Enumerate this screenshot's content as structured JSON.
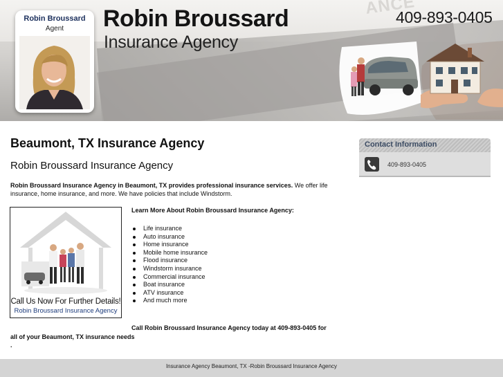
{
  "header": {
    "agent_name": "Robin Broussard",
    "agent_role": "Agent",
    "brand_title": "Robin Broussard",
    "brand_subtitle": "Insurance Agency",
    "phone": "409-893-0405",
    "watermark": "ANCE"
  },
  "main": {
    "title": "Beaumont, TX Insurance Agency",
    "subtitle": "Robin Broussard Insurance Agency",
    "intro_bold": "Robin Broussard Insurance Agency in Beaumont, TX provides professional insurance services.",
    "intro_rest": " We offer life insurance, home insurance, and more. We have policies that include Windstorm.",
    "promo_cta": "Call Us Now For Further Details!",
    "promo_name": "Robin Broussard Insurance Agency",
    "learn_heading": "Learn More About Robin Broussard Insurance Agency:",
    "services": [
      "Life insurance",
      "Auto insurance",
      "Home insurance",
      "Mobile home insurance",
      "Flood insurance",
      "Windstorm insurance",
      "Commercial insurance",
      "Boat insurance",
      "ATV insurance",
      "And much more"
    ],
    "closing_line1": "Call Robin Broussard Insurance Agency today at 409-893-0405 for",
    "closing_line2_bold": "all of your Beaumont, TX insurance needs",
    "closing_line2_end": "."
  },
  "sidebar": {
    "contact_title": "Contact Information",
    "contact_phone": "409-893-0405"
  },
  "footer": {
    "text": "Insurance Agency Beaumont, TX -Robin Broussard Insurance Agency"
  },
  "colors": {
    "agent_name": "#1b2f5c",
    "contact_title": "#3b4b63",
    "footer_bg": "#d4d4d4"
  }
}
